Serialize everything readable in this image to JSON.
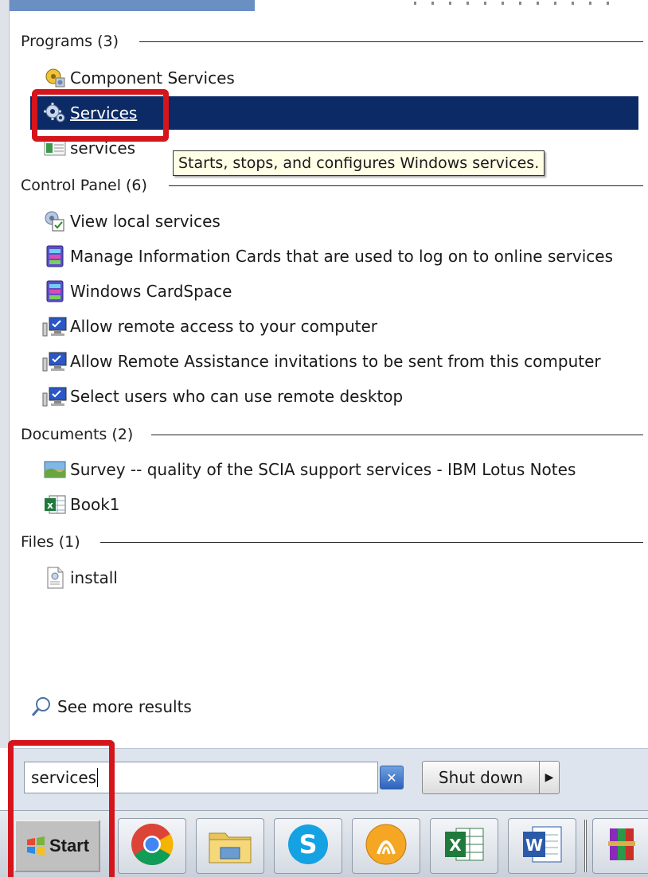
{
  "groups": [
    {
      "header": "Programs (3)",
      "items": [
        {
          "label": "Component Services",
          "icon": "component-services-icon"
        },
        {
          "label": "Services",
          "icon": "gear-icon",
          "selected": true
        },
        {
          "label": "services",
          "icon": "document-icon"
        }
      ]
    },
    {
      "header": "Control Panel (6)",
      "items": [
        {
          "label": "View local services",
          "icon": "services-checklist-icon"
        },
        {
          "label": "Manage Information Cards that are used to log on to online services",
          "icon": "cardspace-icon"
        },
        {
          "label": "Windows CardSpace",
          "icon": "cardspace-icon"
        },
        {
          "label": "Allow remote access to your computer",
          "icon": "remote-computer-icon"
        },
        {
          "label": "Allow Remote Assistance invitations to be sent from this computer",
          "icon": "remote-computer-icon"
        },
        {
          "label": "Select users who can use remote desktop",
          "icon": "remote-computer-icon"
        }
      ]
    },
    {
      "header": "Documents (2)",
      "items": [
        {
          "label": "Survey -- quality of the SCIA support services - IBM Lotus Notes",
          "icon": "image-doc-icon"
        },
        {
          "label": "Book1",
          "icon": "excel-file-icon"
        }
      ]
    },
    {
      "header": "Files (1)",
      "items": [
        {
          "label": "install",
          "icon": "settings-file-icon"
        }
      ]
    }
  ],
  "tooltip": "Starts, stops, and configures Windows services.",
  "see_more": "See more results",
  "search": {
    "value": "services"
  },
  "shutdown_label": "Shut down",
  "start_label": "Start",
  "taskbar_apps": [
    "chrome-icon",
    "file-explorer-icon",
    "skype-icon",
    "lotus-notes-icon",
    "excel-icon",
    "word-icon",
    "winrar-icon"
  ],
  "colors": {
    "highlight": "#0c2a66",
    "annotation": "#d4151b",
    "tooltip_bg": "#ffffe6"
  }
}
